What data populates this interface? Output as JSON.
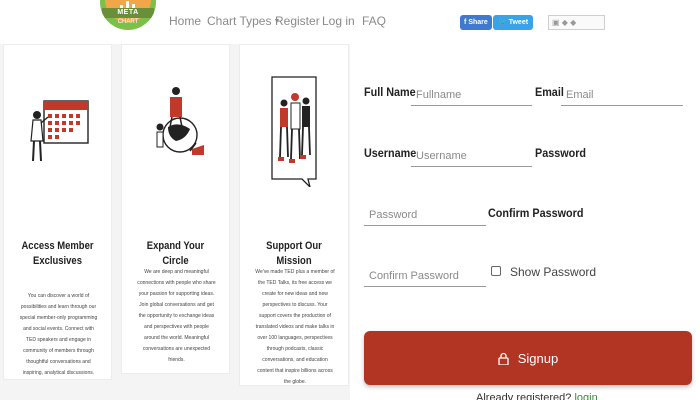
{
  "header": {
    "logo_text": "META",
    "logo_subtext": "CHART",
    "nav": [
      {
        "label": "Home"
      },
      {
        "label": "Chart Types"
      },
      {
        "label": "Register"
      },
      {
        "label": "Log in"
      },
      {
        "label": "FAQ"
      }
    ],
    "share_label": "Share",
    "tweet_label": "Tweet"
  },
  "cards": [
    {
      "title": "Access Member Exclusives",
      "body": "You can discover a world of possibilities and learn through our special member-only programming and social events. Connect with TED speakers and engage in community of members through thoughtful conversations and inspiring, analytical discussions."
    },
    {
      "title": "Expand Your Circle",
      "body": "We are deep and meaningful connections with people who share your passion for supporting ideas. Join global conversations and get the opportunity to exchange ideas and perspectives with people around the world. Meaningful conversations are unexpected friends."
    },
    {
      "title": "Support Our Mission",
      "body": "We've made TED plus a member of the TED Talks, its free access we create for new ideas and new perspectives to discuss. Your support covers the production of translated videos and make talks in over 100 languages, perspectives through podcasts, classic conversations, and education content that inspire billions across the globe."
    }
  ],
  "form": {
    "fullname": {
      "label": "Full Name",
      "placeholder": "Fullname",
      "value": ""
    },
    "email": {
      "label": "Email",
      "placeholder": "Email",
      "value": ""
    },
    "username": {
      "label": "Username",
      "placeholder": "Username",
      "value": ""
    },
    "password": {
      "label": "Password",
      "placeholder": "Password",
      "value": ""
    },
    "confirm_password": {
      "label": "Confirm Password",
      "placeholder": "Confirm Password",
      "value": ""
    },
    "show_password_label": "Show Password",
    "signup_label": "Signup",
    "already_text": "Already registered?",
    "login_link": "login"
  },
  "colors": {
    "accent": "#b23523",
    "share": "#3f7ad0",
    "tweet": "#3aa2e8",
    "link": "#3b8a3b"
  }
}
